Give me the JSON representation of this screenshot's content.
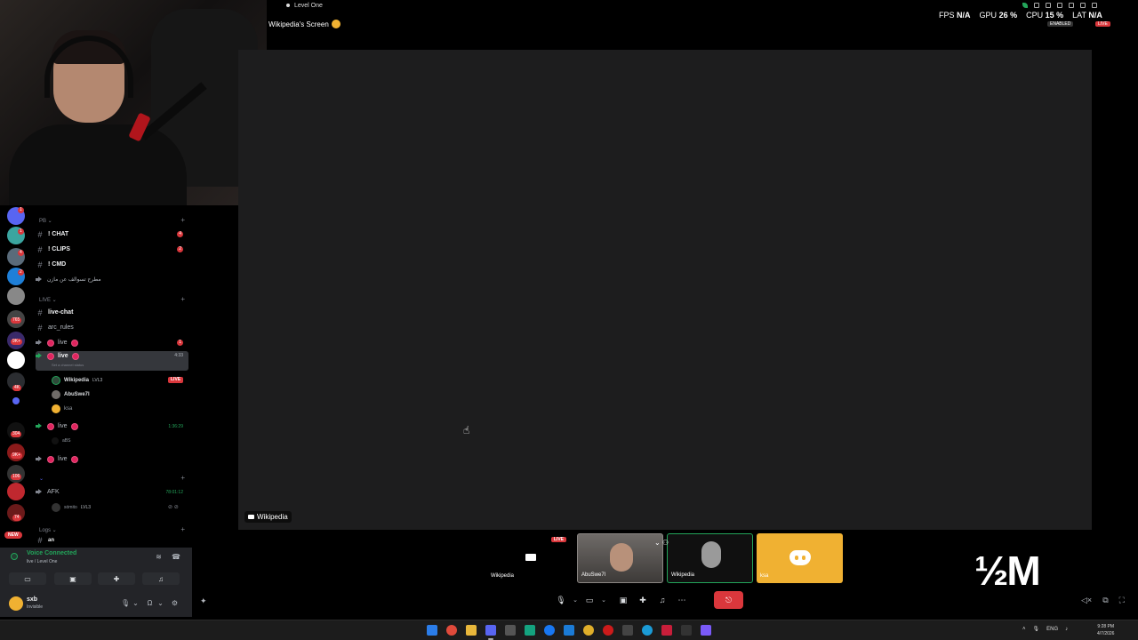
{
  "window": {
    "title": "Level One"
  },
  "stream": {
    "title": "Wikipedia's Screen",
    "label": "Wikipedia"
  },
  "overlay": {
    "fps_label": "FPS",
    "fps_value": "N/A",
    "gpu_label": "GPU",
    "gpu_value": "26 %",
    "cpu_label": "CPU",
    "cpu_value": "15 %",
    "lat_label": "LAT",
    "lat_value": "N/A",
    "enabled_badge": "ENABLED",
    "live_badge": "LIVE"
  },
  "server_badges": [
    "1",
    "1",
    "4",
    "2",
    "765",
    "9K+",
    "4K",
    "304",
    "9K+",
    "106",
    "74",
    "1"
  ],
  "new_badge": "NEW",
  "channels": {
    "category1": "PB",
    "chat": {
      "name": "! CHAT",
      "count": "4"
    },
    "clips": {
      "name": "! CLIPS",
      "count": "2"
    },
    "cmd": {
      "name": "! CMD"
    },
    "voice1": "مطرح تسوالف عن مازن",
    "category2": "LIVE",
    "live_chat": "live-chat",
    "arc_rules": "arc_rules",
    "live1": {
      "name": "live",
      "count": "1"
    },
    "live2": {
      "name": "live",
      "time": "4:33",
      "status": "Set a channel status"
    },
    "members": [
      {
        "name": "Wikipedia",
        "tag": "LVL3"
      },
      {
        "name": "AbuSwe7l",
        "tag": ""
      },
      {
        "name": "ksa",
        "tag": ""
      }
    ],
    "live_tag": "LIVE",
    "live3": {
      "name": "live",
      "time": "1:36:29"
    },
    "live3_member": "aBS",
    "live4": {
      "name": "live"
    },
    "afk": {
      "name": "AFK",
      "time": "78:01:12"
    },
    "afk_member": {
      "name": "sómito",
      "tag": "LVL3"
    },
    "category3": "Logs",
    "logs_channel": "an"
  },
  "voice": {
    "status": "Voice Connected",
    "sub": "live / Level One"
  },
  "user": {
    "name": "sxb",
    "status": "Invisible"
  },
  "tiles": [
    {
      "name": "Wikipedia",
      "badge": "LIVE"
    },
    {
      "name": "AbuSwe7l"
    },
    {
      "name": "Wikipedia"
    },
    {
      "name": "ksa"
    }
  ],
  "controls": {
    "end_call": "⎋"
  },
  "brand_mark": "½M",
  "taskbar": {
    "lang": "ENG",
    "time": "9:28 PM",
    "date": "4/7/2026"
  },
  "colors": {
    "accent_green": "#23a55a",
    "live_red": "#da373c",
    "tile_yellow": "#f0b132"
  }
}
